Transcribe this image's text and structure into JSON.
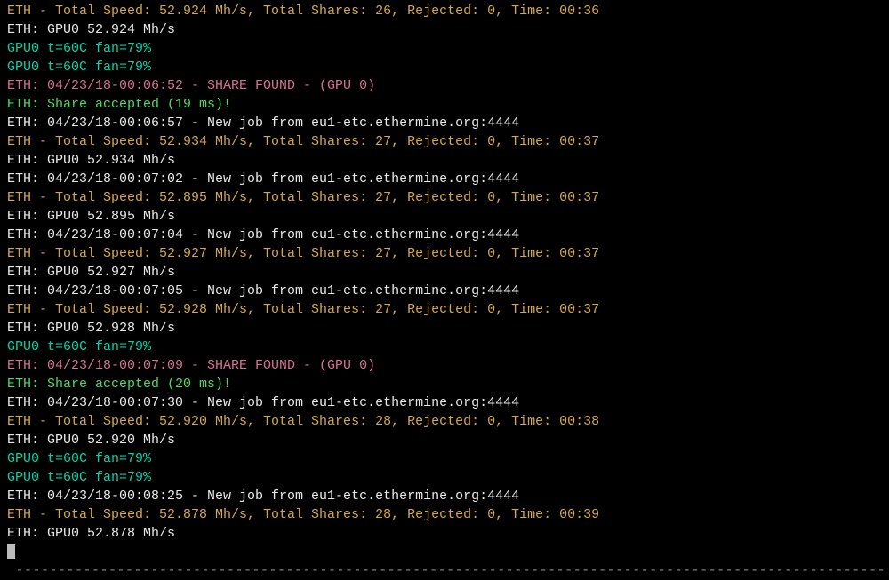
{
  "lines": [
    {
      "cls": "c-orange",
      "text": "ETH - Total Speed: 52.924 Mh/s, Total Shares: 26, Rejected: 0, Time: 00:36"
    },
    {
      "cls": "c-white",
      "text": "ETH: GPU0 52.924 Mh/s"
    },
    {
      "cls": "c-cyan",
      "text": "GPU0 t=60C fan=79%"
    },
    {
      "cls": "c-cyan",
      "text": "GPU0 t=60C fan=79%"
    },
    {
      "cls": "c-magenta",
      "text": "ETH: 04/23/18-00:06:52 - SHARE FOUND - (GPU 0)"
    },
    {
      "cls": "c-green",
      "text": "ETH: Share accepted (19 ms)!"
    },
    {
      "cls": "c-white",
      "text": "ETH: 04/23/18-00:06:57 - New job from eu1-etc.ethermine.org:4444"
    },
    {
      "cls": "c-orange",
      "text": "ETH - Total Speed: 52.934 Mh/s, Total Shares: 27, Rejected: 0, Time: 00:37"
    },
    {
      "cls": "c-white",
      "text": "ETH: GPU0 52.934 Mh/s"
    },
    {
      "cls": "c-white",
      "text": "ETH: 04/23/18-00:07:02 - New job from eu1-etc.ethermine.org:4444"
    },
    {
      "cls": "c-orange",
      "text": "ETH - Total Speed: 52.895 Mh/s, Total Shares: 27, Rejected: 0, Time: 00:37"
    },
    {
      "cls": "c-white",
      "text": "ETH: GPU0 52.895 Mh/s"
    },
    {
      "cls": "c-white",
      "text": "ETH: 04/23/18-00:07:04 - New job from eu1-etc.ethermine.org:4444"
    },
    {
      "cls": "c-orange",
      "text": "ETH - Total Speed: 52.927 Mh/s, Total Shares: 27, Rejected: 0, Time: 00:37"
    },
    {
      "cls": "c-white",
      "text": "ETH: GPU0 52.927 Mh/s"
    },
    {
      "cls": "c-white",
      "text": "ETH: 04/23/18-00:07:05 - New job from eu1-etc.ethermine.org:4444"
    },
    {
      "cls": "c-orange",
      "text": "ETH - Total Speed: 52.928 Mh/s, Total Shares: 27, Rejected: 0, Time: 00:37"
    },
    {
      "cls": "c-white",
      "text": "ETH: GPU0 52.928 Mh/s"
    },
    {
      "cls": "c-cyan",
      "text": "GPU0 t=60C fan=79%"
    },
    {
      "cls": "c-magenta",
      "text": "ETH: 04/23/18-00:07:09 - SHARE FOUND - (GPU 0)"
    },
    {
      "cls": "c-green",
      "text": "ETH: Share accepted (20 ms)!"
    },
    {
      "cls": "c-white",
      "text": "ETH: 04/23/18-00:07:30 - New job from eu1-etc.ethermine.org:4444"
    },
    {
      "cls": "c-orange",
      "text": "ETH - Total Speed: 52.920 Mh/s, Total Shares: 28, Rejected: 0, Time: 00:38"
    },
    {
      "cls": "c-white",
      "text": "ETH: GPU0 52.920 Mh/s"
    },
    {
      "cls": "c-cyan",
      "text": "GPU0 t=60C fan=79%"
    },
    {
      "cls": "c-cyan",
      "text": "GPU0 t=60C fan=79%"
    },
    {
      "cls": "c-white",
      "text": "ETH: 04/23/18-00:08:25 - New job from eu1-etc.ethermine.org:4444"
    },
    {
      "cls": "c-orange",
      "text": "ETH - Total Speed: 52.878 Mh/s, Total Shares: 28, Rejected: 0, Time: 00:39"
    },
    {
      "cls": "c-white",
      "text": "ETH: GPU0 52.878 Mh/s"
    }
  ],
  "separator": " -------------------------------------------------------------------------------------------------------"
}
